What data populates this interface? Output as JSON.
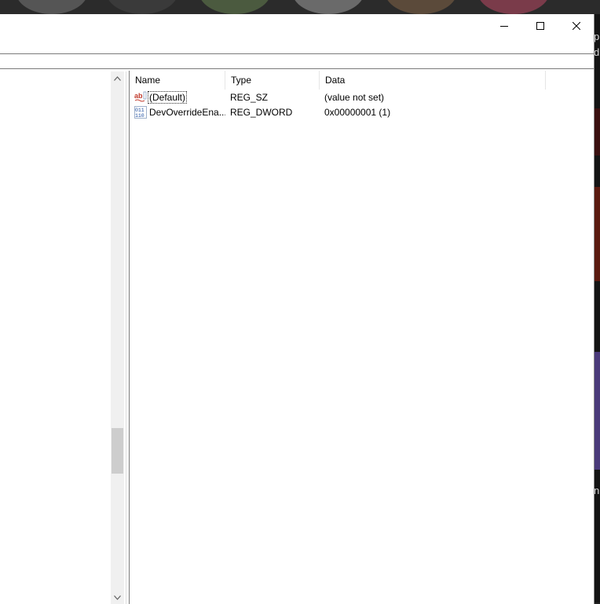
{
  "window": {
    "controls": {
      "minimize": "minimize",
      "maximize": "maximize",
      "close": "close"
    }
  },
  "list": {
    "columns": [
      "Name",
      "Type",
      "Data"
    ],
    "rows": [
      {
        "icon": "string-value-icon",
        "name": "(Default)",
        "type": "REG_SZ",
        "data": "(value not set)"
      },
      {
        "icon": "binary-value-icon",
        "name": "DevOverrideEna...",
        "type": "REG_DWORD",
        "data": "0x00000001 (1)"
      }
    ]
  },
  "background": {
    "right_edge_text": [
      "p",
      "d",
      "n"
    ]
  }
}
